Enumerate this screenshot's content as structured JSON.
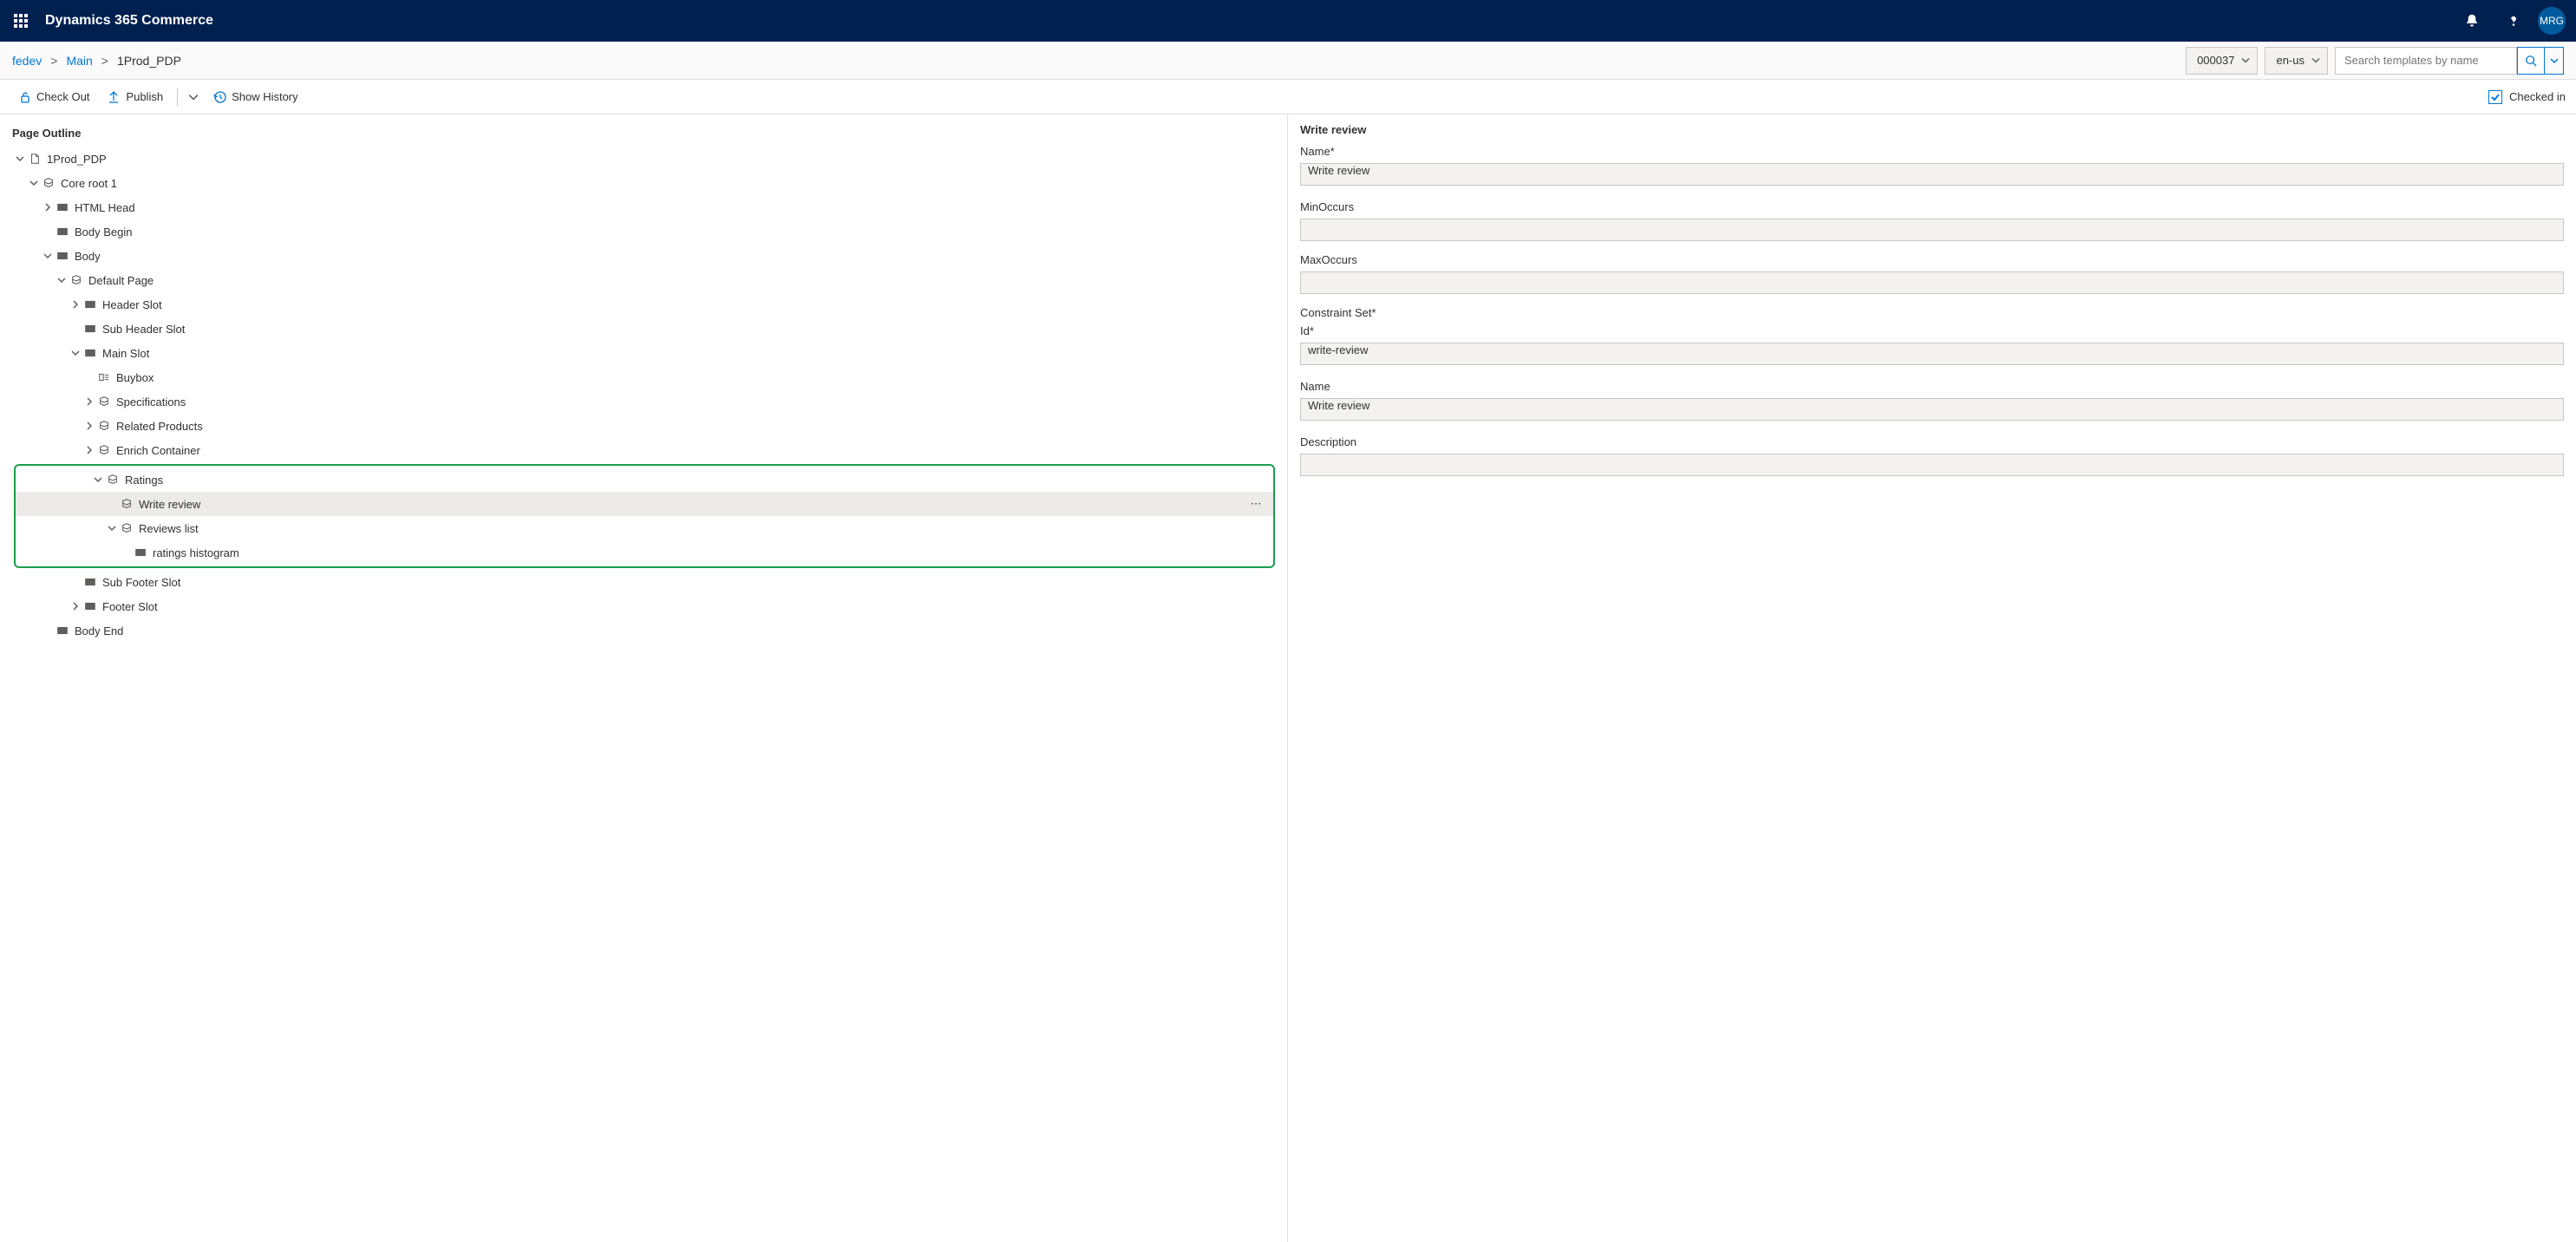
{
  "header": {
    "app_title": "Dynamics 365 Commerce",
    "avatar_initials": "MRG"
  },
  "breadcrumb": {
    "items": [
      "fedev",
      "Main",
      "1Prod_PDP"
    ],
    "site_id": "000037",
    "locale": "en-us",
    "search_placeholder": "Search templates by name"
  },
  "cmdbar": {
    "checkout": "Check Out",
    "publish": "Publish",
    "history": "Show History",
    "checked_in": "Checked in"
  },
  "outline": {
    "title": "Page Outline",
    "rows": [
      {
        "depth": 0,
        "chev": "down",
        "icon": "doc",
        "label": "1Prod_PDP"
      },
      {
        "depth": 1,
        "chev": "down",
        "icon": "module",
        "label": "Core root 1"
      },
      {
        "depth": 2,
        "chev": "right",
        "icon": "slot",
        "label": "HTML Head"
      },
      {
        "depth": 2,
        "chev": "none",
        "icon": "slot",
        "label": "Body Begin"
      },
      {
        "depth": 2,
        "chev": "down",
        "icon": "slot",
        "label": "Body"
      },
      {
        "depth": 3,
        "chev": "down",
        "icon": "module",
        "label": "Default Page"
      },
      {
        "depth": 4,
        "chev": "right",
        "icon": "slot",
        "label": "Header Slot"
      },
      {
        "depth": 4,
        "chev": "none",
        "icon": "slot",
        "label": "Sub Header Slot"
      },
      {
        "depth": 4,
        "chev": "down",
        "icon": "slot",
        "label": "Main Slot"
      },
      {
        "depth": 5,
        "chev": "none",
        "icon": "buybox",
        "label": "Buybox"
      },
      {
        "depth": 5,
        "chev": "right",
        "icon": "module",
        "label": "Specifications"
      },
      {
        "depth": 5,
        "chev": "right",
        "icon": "module",
        "label": "Related Products"
      },
      {
        "depth": 5,
        "chev": "right",
        "icon": "module",
        "label": "Enrich Container"
      },
      {
        "depth": 5,
        "chev": "down",
        "icon": "module",
        "label": "Ratings"
      },
      {
        "depth": 6,
        "chev": "none",
        "icon": "module",
        "label": "Write review",
        "selected": true
      },
      {
        "depth": 6,
        "chev": "down",
        "icon": "module",
        "label": "Reviews list"
      },
      {
        "depth": 7,
        "chev": "none",
        "icon": "slot",
        "label": "ratings histogram"
      },
      {
        "depth": 4,
        "chev": "none",
        "icon": "slot",
        "label": "Sub Footer Slot"
      },
      {
        "depth": 4,
        "chev": "right",
        "icon": "slot",
        "label": "Footer Slot"
      },
      {
        "depth": 2,
        "chev": "none",
        "icon": "slot",
        "label": "Body End"
      }
    ]
  },
  "props": {
    "title": "Write review",
    "name_label": "Name*",
    "name_value": "Write review",
    "min_label": "MinOccurs",
    "min_value": "",
    "max_label": "MaxOccurs",
    "max_value": "",
    "constraint_header": "Constraint Set*",
    "id_label": "Id*",
    "id_value": "write-review",
    "name2_label": "Name",
    "name2_value": "Write review",
    "desc_label": "Description",
    "desc_value": ""
  }
}
